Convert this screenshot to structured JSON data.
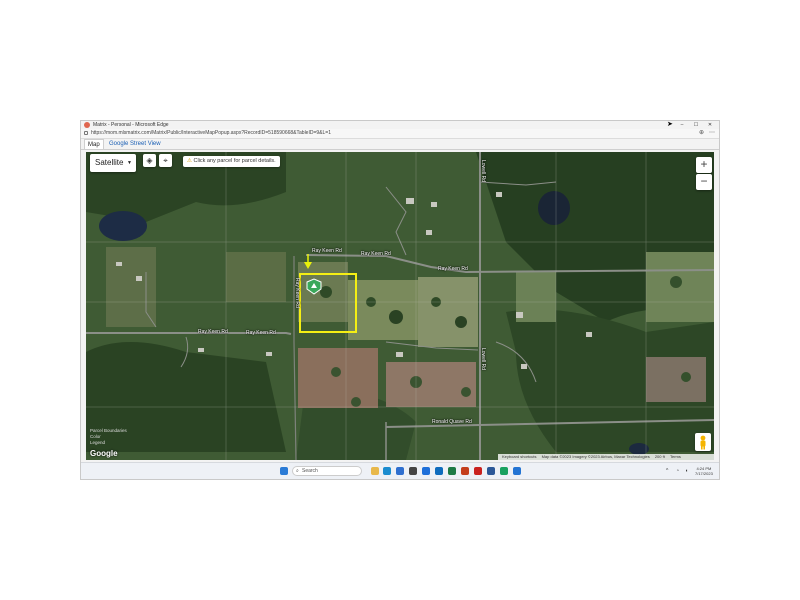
{
  "window": {
    "title": "Matrix - Personal - Microsoft Edge",
    "controls": {
      "minimize": "–",
      "maximize": "☐",
      "close": "✕"
    }
  },
  "address_bar": {
    "url": "https://mom.mlsmatrix.com/Matrix/Public/InteractiveMapPopup.aspx?RecordID=518590668&TableID=9&L=1"
  },
  "tabs": [
    {
      "label": "Map",
      "active": true
    },
    {
      "label": "Google Street View",
      "active": false
    }
  ],
  "map": {
    "type_selector": {
      "label": "Satellite"
    },
    "hint": "Click any parcel for parcel details.",
    "zoom": {
      "in": "+",
      "out": "−"
    },
    "roads": [
      {
        "label": "Ray Keen Rd"
      },
      {
        "label": "Ray Keen Rd"
      },
      {
        "label": "Ray Keen Rd"
      },
      {
        "label": "Ray Keen Rd"
      },
      {
        "label": "Ray Keen Rd"
      },
      {
        "label": "Ray Keen Rd"
      },
      {
        "label": "Lowell Rd"
      },
      {
        "label": "Lowell Rd"
      },
      {
        "label": "Ronald Quave Rd"
      }
    ],
    "legend": [
      "Parcel Boundaries",
      "Color",
      "Legend"
    ],
    "google_logo": "Google",
    "attribution": {
      "shortcuts": "Keyboard shortcuts",
      "data": "Map data ©2023 Imagery ©2023 Airbus, Maxar Technologies",
      "scale": "200 ft",
      "terms": "Terms"
    }
  },
  "taskbar": {
    "search_placeholder": "Search",
    "tray_chevron": "^",
    "time": "4:24 PM",
    "date": "7/17/2023"
  },
  "colors": {
    "selection": "#f5ef14",
    "marker": "#3aa85a",
    "arrow": "#e9f20a"
  }
}
